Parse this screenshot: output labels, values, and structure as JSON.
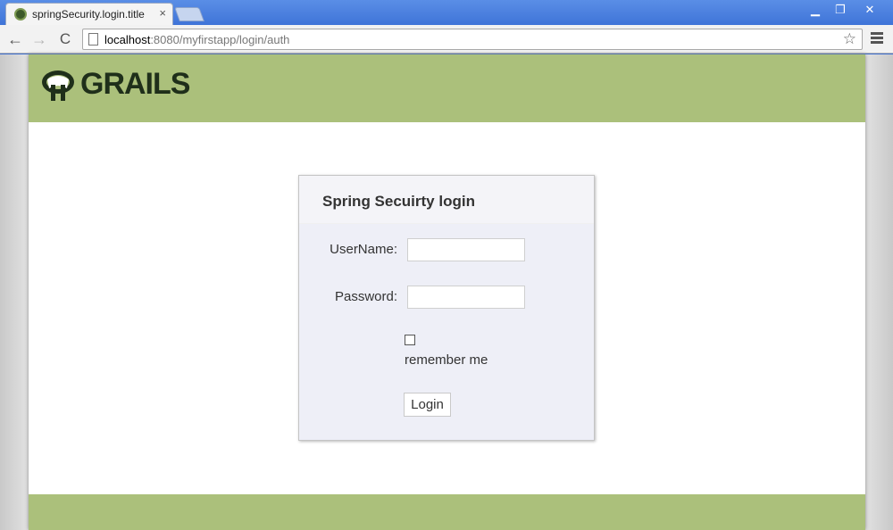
{
  "browser": {
    "tab_title": "springSecurity.login.title",
    "tab_close": "×",
    "url_host": "localhost",
    "url_rest": ":8080/myfirstapp/login/auth",
    "window_controls": {
      "minimize": "▁",
      "restore": "❐",
      "close": "✕"
    },
    "nav": {
      "back": "←",
      "forward": "→",
      "reload": "C"
    },
    "star": "☆"
  },
  "header": {
    "logo_text": "GRAILS"
  },
  "login": {
    "title": "Spring Secuirty login",
    "username_label": "UserName:",
    "username_value": "",
    "password_label": "Password:",
    "password_value": "",
    "remember_label": "remember me",
    "remember_checked": false,
    "submit_label": "Login"
  },
  "colors": {
    "header_green": "#abc07b",
    "login_background": "#eeeff7",
    "titlebar_blue": "#3f74d8"
  }
}
